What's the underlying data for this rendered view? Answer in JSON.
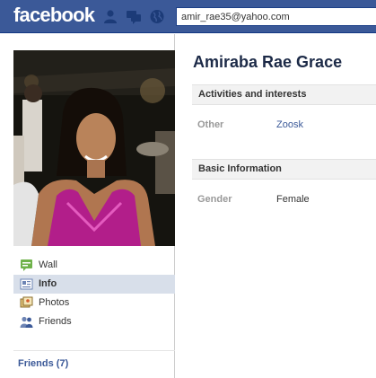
{
  "header": {
    "logo": "facebook",
    "search_value": "amir_rae35@yahoo.com",
    "jewels": [
      "friend-requests-icon",
      "messages-icon",
      "notifications-globe-icon"
    ]
  },
  "profile": {
    "name": "Amiraba Rae Grace"
  },
  "nav": {
    "items": [
      {
        "label": "Wall",
        "icon": "wall-icon"
      },
      {
        "label": "Info",
        "icon": "info-icon",
        "active": true
      },
      {
        "label": "Photos",
        "icon": "photos-icon"
      },
      {
        "label": "Friends",
        "icon": "friends-icon"
      }
    ],
    "friends_link": "Friends (7)"
  },
  "sections": {
    "activities": {
      "title": "Activities and interests",
      "rows": [
        {
          "label": "Other",
          "value": "Zoosk"
        }
      ]
    },
    "basic": {
      "title": "Basic Information",
      "rows": [
        {
          "label": "Gender",
          "value": "Female"
        }
      ]
    }
  },
  "colors": {
    "brand": "#3b5998",
    "active_nav": "#d8dfea",
    "section_bg": "#f2f2f2",
    "label_gray": "#999999"
  }
}
